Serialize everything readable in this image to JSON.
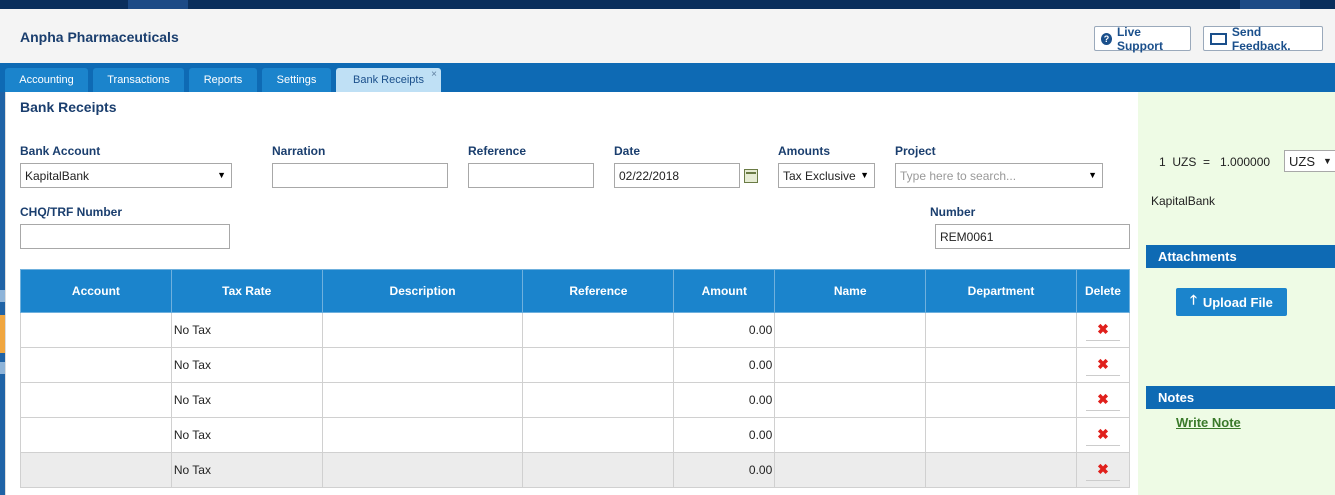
{
  "header": {
    "company": "Anpha Pharmaceuticals",
    "live_support": "Live Support",
    "send_feedback": "Send Feedback."
  },
  "tabs": [
    {
      "label": "Accounting"
    },
    {
      "label": "Transactions"
    },
    {
      "label": "Reports"
    },
    {
      "label": "Settings"
    },
    {
      "label": "Bank Receipts",
      "close": "×"
    }
  ],
  "form": {
    "title": "Bank Receipts",
    "bank_account_label": "Bank Account",
    "bank_account_value": "KapitalBank",
    "narration_label": "Narration",
    "narration_value": "",
    "reference_label": "Reference",
    "reference_value": "",
    "date_label": "Date",
    "date_value": "02/22/2018",
    "amounts_label": "Amounts",
    "amounts_value": "Tax Exclusive",
    "project_label": "Project",
    "project_placeholder": "Type here to search...",
    "chq_label": "CHQ/TRF Number",
    "chq_value": "",
    "number_label": "Number",
    "number_value": "REM0061"
  },
  "table": {
    "headers": [
      "Account",
      "Tax Rate",
      "Description",
      "Reference",
      "Amount",
      "Name",
      "Department",
      "Delete"
    ],
    "rows": [
      {
        "account": "",
        "tax_rate": "No Tax",
        "description": "",
        "reference": "",
        "amount": "0.00",
        "name": "",
        "department": ""
      },
      {
        "account": "",
        "tax_rate": "No Tax",
        "description": "",
        "reference": "",
        "amount": "0.00",
        "name": "",
        "department": ""
      },
      {
        "account": "",
        "tax_rate": "No Tax",
        "description": "",
        "reference": "",
        "amount": "0.00",
        "name": "",
        "department": ""
      },
      {
        "account": "",
        "tax_rate": "No Tax",
        "description": "",
        "reference": "",
        "amount": "0.00",
        "name": "",
        "department": ""
      },
      {
        "account": "",
        "tax_rate": "No Tax",
        "description": "",
        "reference": "",
        "amount": "0.00",
        "name": "",
        "department": ""
      }
    ],
    "delete_glyph": "✖"
  },
  "sidebar": {
    "rate_text": "1  UZS  =   1.000000",
    "currency": "UZS",
    "bank_name": "KapitalBank",
    "attachments_title": "Attachments",
    "upload_label": "Upload File",
    "notes_title": "Notes",
    "write_note": "Write Note"
  },
  "colors": {
    "brand_dark": "#0a2e5c",
    "tab_bar": "#0e6ab4",
    "table_header": "#1b84cc",
    "delete_red": "#e0201c",
    "sidebar_bg": "#eefbe5"
  }
}
